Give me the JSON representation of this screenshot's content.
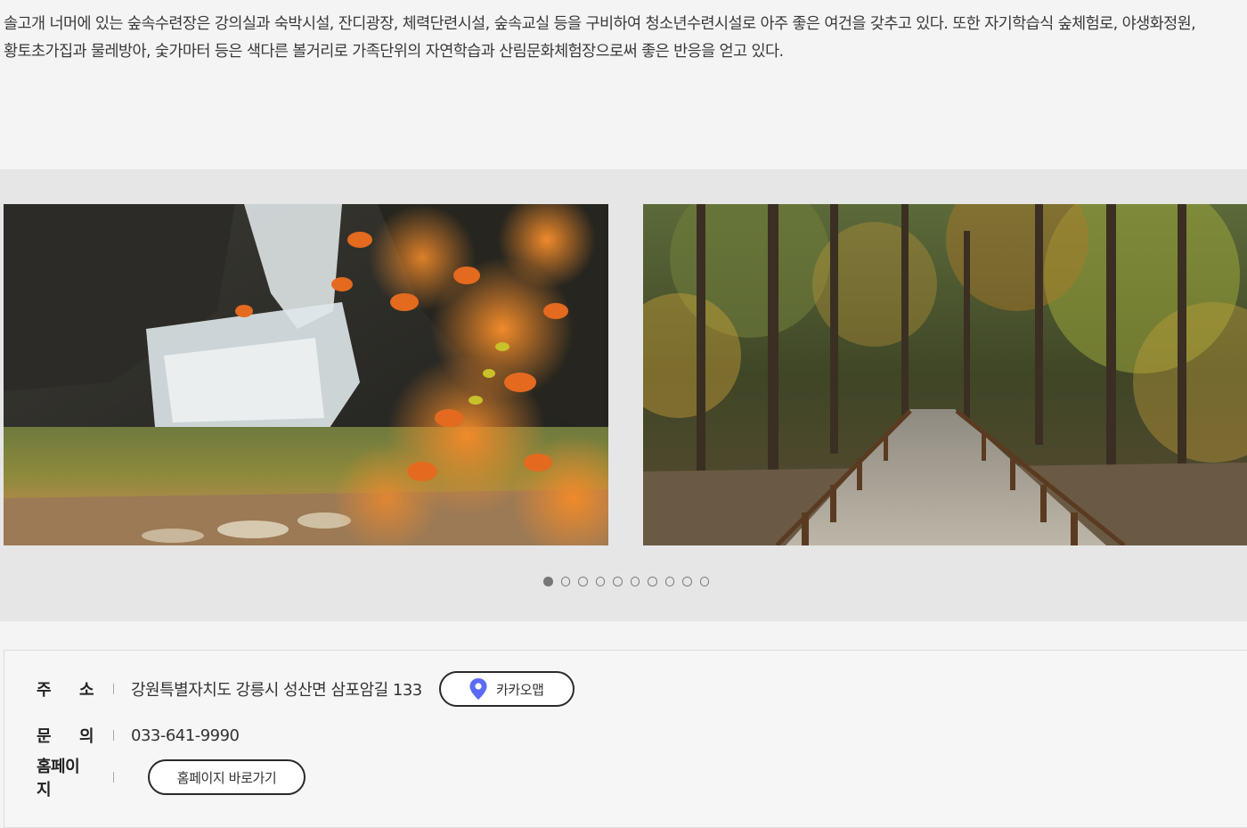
{
  "description": {
    "line1": "솔고개 너머에 있는 숲속수련장은 강의실과 숙박시설, 잔디광장, 체력단련시설, 숲속교실 등을 구비하여 청소년수련시설로 아주 좋은 여건을 갖추고 있다. 또한 자기학습식 숲체험로, 야생화정원,",
    "line2": "황토초가집과 물레방아, 숯가마터 등은 색다른 볼거리로 가족단위의 자연학습과 산림문화체험장으로써 좋은 반응을 얻고 있다."
  },
  "gallery": {
    "slides": [
      {
        "id": "waterfall-autumn-leaves"
      },
      {
        "id": "forest-wooden-boardwalk"
      }
    ],
    "dot_count": 10,
    "active_dot": 0
  },
  "info": {
    "address_label_a": "주",
    "address_label_b": "소",
    "address_value": "강원특별자치도 강릉시 성산면 삼포암길 133",
    "map_button_label": "카카오맵",
    "map_icon": "map-pin-icon",
    "map_icon_color": "#5b6bf5",
    "contact_label_a": "문",
    "contact_label_b": "의",
    "contact_value": "033-641-9990",
    "homepage_label": "홈페이지",
    "homepage_button_label": "홈페이지 바로가기"
  }
}
